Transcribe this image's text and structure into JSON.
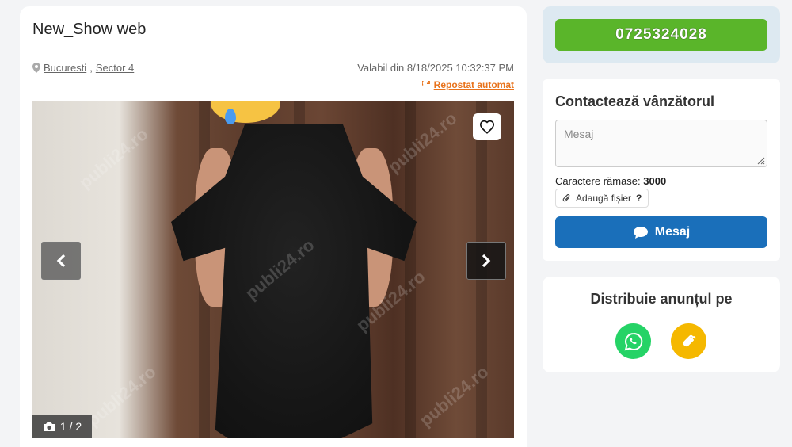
{
  "listing": {
    "title": "New_Show web",
    "location_city": "Bucuresti",
    "location_separator": ",",
    "location_sector": "Sector 4",
    "valid_text": "Valabil din 8/18/2025 10:32:37 PM",
    "repost_label": "Repostat automat",
    "photo_counter": "1 / 2",
    "watermark": "publi24.ro"
  },
  "phone": {
    "number": "0725324028",
    "color": "#5ab52a"
  },
  "contact": {
    "title": "Contactează vânzătorul",
    "message_placeholder": "Mesaj",
    "chars_label": "Caractere rămase:",
    "chars_value": "3000",
    "attach_label": "Adaugă fișier",
    "attach_help": "?",
    "send_label": "Mesaj",
    "send_color": "#1a6fba"
  },
  "share": {
    "title": "Distribuie anunțul pe"
  },
  "icons": [
    "map-pin-icon",
    "refresh-icon",
    "heart-icon",
    "chevron-left-icon",
    "chevron-right-icon",
    "camera-icon",
    "paperclip-icon",
    "chat-bubble-icon",
    "whatsapp-icon",
    "link-icon"
  ]
}
